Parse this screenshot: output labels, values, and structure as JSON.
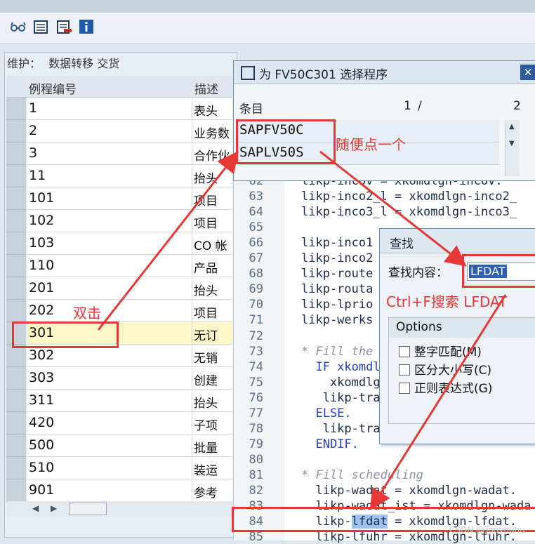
{
  "toolbar": {
    "icons": [
      "glasses-icon",
      "table-icon",
      "delete-list-icon",
      "info-icon"
    ]
  },
  "maintenance": {
    "label": "维护：",
    "value": "数据转移 交货"
  },
  "table": {
    "headers": [
      "例程编号",
      "描述"
    ],
    "rows": [
      {
        "id": "1",
        "desc": "表头"
      },
      {
        "id": "2",
        "desc": "业务数"
      },
      {
        "id": "3",
        "desc": "合作伙"
      },
      {
        "id": "11",
        "desc": "抬头"
      },
      {
        "id": "101",
        "desc": "项目"
      },
      {
        "id": "102",
        "desc": "项目"
      },
      {
        "id": "103",
        "desc": "CO 帐"
      },
      {
        "id": "110",
        "desc": "产品"
      },
      {
        "id": "201",
        "desc": "抬头"
      },
      {
        "id": "202",
        "desc": "项目"
      },
      {
        "id": "301",
        "desc": "无订"
      },
      {
        "id": "302",
        "desc": "无销"
      },
      {
        "id": "303",
        "desc": "创建"
      },
      {
        "id": "311",
        "desc": "抬头"
      },
      {
        "id": "420",
        "desc": "子项"
      },
      {
        "id": "500",
        "desc": "批量"
      },
      {
        "id": "510",
        "desc": "装运"
      },
      {
        "id": "901",
        "desc": "参考"
      }
    ],
    "selected_row": "301"
  },
  "select_dialog": {
    "title": "为 FV50C301 选择程序",
    "header_label": "条目",
    "page_current": "1",
    "page_sep": "/",
    "page_total": "2",
    "items": [
      "SAPFV50C",
      "SAPLV50S"
    ]
  },
  "code": {
    "lines": [
      {
        "n": "62",
        "t": "likp-incov = xkomdlgn-incov."
      },
      {
        "n": "63",
        "t": "likp-inco2_l = xkomdlgn-inco2_"
      },
      {
        "n": "64",
        "t": "likp-inco3_l = xkomdlgn-inco3_"
      },
      {
        "n": "65",
        "t": ""
      },
      {
        "n": "66",
        "t": "likp-inco1"
      },
      {
        "n": "67",
        "t": "likp-inco2"
      },
      {
        "n": "68",
        "t": "likp-route"
      },
      {
        "n": "69",
        "t": "likp-routa"
      },
      {
        "n": "70",
        "t": "likp-lprio"
      },
      {
        "n": "71",
        "t": "likp-werks"
      },
      {
        "n": "72",
        "t": ""
      },
      {
        "n": "73",
        "t": "* Fill the T"
      },
      {
        "n": "74",
        "t": "  IF xkomdlg"
      },
      {
        "n": "75",
        "t": "    xkomdlg"
      },
      {
        "n": "76",
        "t": "   likp-tra"
      },
      {
        "n": "77",
        "t": "  ELSE."
      },
      {
        "n": "78",
        "t": "   likp-tra"
      },
      {
        "n": "79",
        "t": "  ENDIF."
      },
      {
        "n": "80",
        "t": ""
      },
      {
        "n": "81",
        "t": "* Fill scheduling"
      },
      {
        "n": "82",
        "t": "  likp-wadat = xkomdlgn-wadat."
      },
      {
        "n": "83",
        "t": "  likp-wadat_ist = xkomdlgn-wada"
      },
      {
        "n": "84",
        "t": "  likp-lfdat = xkomdlgn-lfdat."
      },
      {
        "n": "85",
        "t": "  likp-lfuhr = xkomdlgn-lfuhr."
      }
    ]
  },
  "find_dialog": {
    "title": "查找",
    "label": "查找内容：",
    "value": "LFDAT",
    "options_title": "Options",
    "options": [
      "整字匹配(M)",
      "区分大小写(C)",
      "正则表达式(G)"
    ]
  },
  "annotations": {
    "double_click": "双击",
    "pick_one": "随便点一个",
    "search_hint": "Ctrl+F搜索 LFDAT"
  },
  "watermark": "CSDN @Tonyhuhu"
}
